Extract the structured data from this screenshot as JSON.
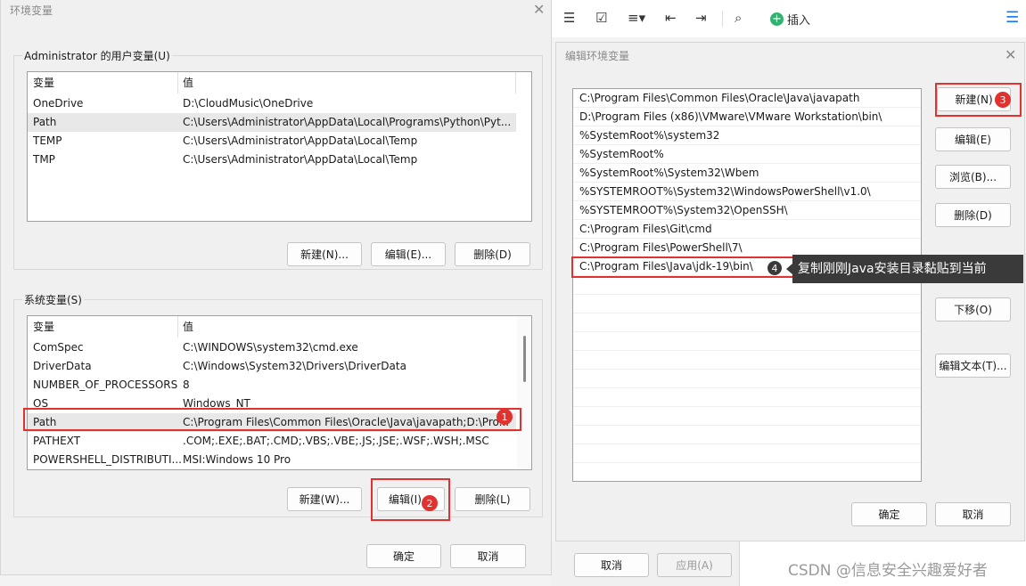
{
  "toolbar": {
    "insert_label": "插入"
  },
  "env_dialog": {
    "title": "环境变量",
    "user_group_label": "Administrator 的用户变量(U)",
    "user_columns": [
      "变量",
      "值"
    ],
    "user_rows": [
      {
        "name": "OneDrive",
        "value": "D:\\CloudMusic\\OneDrive"
      },
      {
        "name": "Path",
        "value": "C:\\Users\\Administrator\\AppData\\Local\\Programs\\Python\\Pyt..."
      },
      {
        "name": "TEMP",
        "value": "C:\\Users\\Administrator\\AppData\\Local\\Temp"
      },
      {
        "name": "TMP",
        "value": "C:\\Users\\Administrator\\AppData\\Local\\Temp"
      }
    ],
    "user_buttons": {
      "new": "新建(N)...",
      "edit": "编辑(E)...",
      "delete": "删除(D)"
    },
    "system_group_label": "系统变量(S)",
    "system_columns": [
      "变量",
      "值"
    ],
    "system_rows": [
      {
        "name": "ComSpec",
        "value": "C:\\WINDOWS\\system32\\cmd.exe"
      },
      {
        "name": "DriverData",
        "value": "C:\\Windows\\System32\\Drivers\\DriverData"
      },
      {
        "name": "NUMBER_OF_PROCESSORS",
        "value": "8"
      },
      {
        "name": "OS",
        "value": "Windows_NT"
      },
      {
        "name": "Path",
        "value": "C:\\Program Files\\Common Files\\Oracle\\Java\\javapath;D:\\Pro..."
      },
      {
        "name": "PATHEXT",
        "value": ".COM;.EXE;.BAT;.CMD;.VBS;.VBE;.JS;.JSE;.WSF;.WSH;.MSC"
      },
      {
        "name": "POWERSHELL_DISTRIBUTI...",
        "value": "MSI:Windows 10 Pro"
      }
    ],
    "system_buttons": {
      "new": "新建(W)...",
      "edit": "编辑(I)...",
      "delete": "删除(L)"
    },
    "ok": "确定",
    "cancel": "取消"
  },
  "behind_buttons": {
    "cancel": "取消",
    "apply": "应用(A)"
  },
  "edit_dialog": {
    "title": "编辑环境变量",
    "paths": [
      "C:\\Program Files\\Common Files\\Oracle\\Java\\javapath",
      "D:\\Program Files (x86)\\VMware\\VMware Workstation\\bin\\",
      "%SystemRoot%\\system32",
      "%SystemRoot%",
      "%SystemRoot%\\System32\\Wbem",
      "%SYSTEMROOT%\\System32\\WindowsPowerShell\\v1.0\\",
      "%SYSTEMROOT%\\System32\\OpenSSH\\",
      "C:\\Program Files\\Git\\cmd",
      "C:\\Program Files\\PowerShell\\7\\",
      "C:\\Program Files\\Java\\jdk-19\\bin\\"
    ],
    "buttons": {
      "new": "新建(N)",
      "edit": "编辑(E)",
      "browse": "浏览(B)...",
      "delete": "删除(D)",
      "move_down": "下移(O)",
      "edit_text": "编辑文本(T)..."
    },
    "ok": "确定",
    "cancel": "取消"
  },
  "annotations": {
    "badge1": "1",
    "badge2": "2",
    "badge3": "3",
    "badge4": "4",
    "tooltip": "复制刚刚Java安装目录黏贴到当前"
  },
  "watermark": "CSDN @信息安全兴趣爱好者",
  "colors": {
    "accent_red": "#e0322f",
    "tooltip_bg": "#3a3a3a",
    "insert_green": "#2fb36f",
    "menu_blue": "#1677ff"
  }
}
